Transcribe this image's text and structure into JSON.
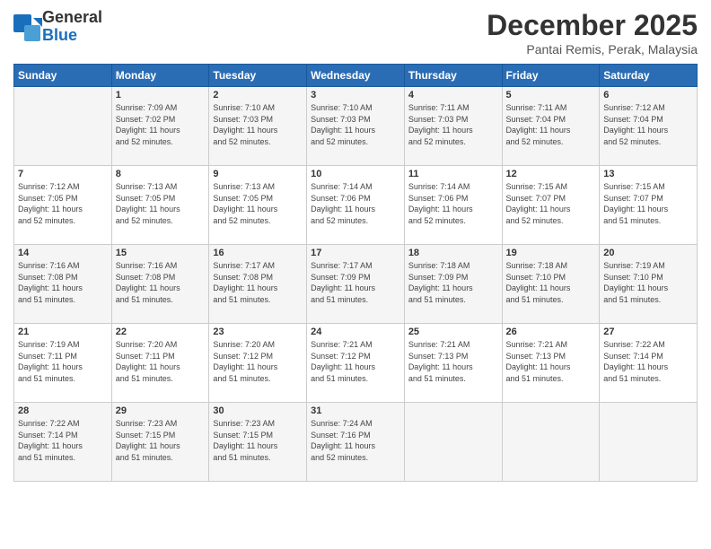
{
  "logo": {
    "line1": "General",
    "line2": "Blue"
  },
  "title": "December 2025",
  "subtitle": "Pantai Remis, Perak, Malaysia",
  "days_header": [
    "Sunday",
    "Monday",
    "Tuesday",
    "Wednesday",
    "Thursday",
    "Friday",
    "Saturday"
  ],
  "weeks": [
    [
      {
        "day": "",
        "info": ""
      },
      {
        "day": "1",
        "info": "Sunrise: 7:09 AM\nSunset: 7:02 PM\nDaylight: 11 hours\nand 52 minutes."
      },
      {
        "day": "2",
        "info": "Sunrise: 7:10 AM\nSunset: 7:03 PM\nDaylight: 11 hours\nand 52 minutes."
      },
      {
        "day": "3",
        "info": "Sunrise: 7:10 AM\nSunset: 7:03 PM\nDaylight: 11 hours\nand 52 minutes."
      },
      {
        "day": "4",
        "info": "Sunrise: 7:11 AM\nSunset: 7:03 PM\nDaylight: 11 hours\nand 52 minutes."
      },
      {
        "day": "5",
        "info": "Sunrise: 7:11 AM\nSunset: 7:04 PM\nDaylight: 11 hours\nand 52 minutes."
      },
      {
        "day": "6",
        "info": "Sunrise: 7:12 AM\nSunset: 7:04 PM\nDaylight: 11 hours\nand 52 minutes."
      }
    ],
    [
      {
        "day": "7",
        "info": "Sunrise: 7:12 AM\nSunset: 7:05 PM\nDaylight: 11 hours\nand 52 minutes."
      },
      {
        "day": "8",
        "info": "Sunrise: 7:13 AM\nSunset: 7:05 PM\nDaylight: 11 hours\nand 52 minutes."
      },
      {
        "day": "9",
        "info": "Sunrise: 7:13 AM\nSunset: 7:05 PM\nDaylight: 11 hours\nand 52 minutes."
      },
      {
        "day": "10",
        "info": "Sunrise: 7:14 AM\nSunset: 7:06 PM\nDaylight: 11 hours\nand 52 minutes."
      },
      {
        "day": "11",
        "info": "Sunrise: 7:14 AM\nSunset: 7:06 PM\nDaylight: 11 hours\nand 52 minutes."
      },
      {
        "day": "12",
        "info": "Sunrise: 7:15 AM\nSunset: 7:07 PM\nDaylight: 11 hours\nand 52 minutes."
      },
      {
        "day": "13",
        "info": "Sunrise: 7:15 AM\nSunset: 7:07 PM\nDaylight: 11 hours\nand 51 minutes."
      }
    ],
    [
      {
        "day": "14",
        "info": "Sunrise: 7:16 AM\nSunset: 7:08 PM\nDaylight: 11 hours\nand 51 minutes."
      },
      {
        "day": "15",
        "info": "Sunrise: 7:16 AM\nSunset: 7:08 PM\nDaylight: 11 hours\nand 51 minutes."
      },
      {
        "day": "16",
        "info": "Sunrise: 7:17 AM\nSunset: 7:08 PM\nDaylight: 11 hours\nand 51 minutes."
      },
      {
        "day": "17",
        "info": "Sunrise: 7:17 AM\nSunset: 7:09 PM\nDaylight: 11 hours\nand 51 minutes."
      },
      {
        "day": "18",
        "info": "Sunrise: 7:18 AM\nSunset: 7:09 PM\nDaylight: 11 hours\nand 51 minutes."
      },
      {
        "day": "19",
        "info": "Sunrise: 7:18 AM\nSunset: 7:10 PM\nDaylight: 11 hours\nand 51 minutes."
      },
      {
        "day": "20",
        "info": "Sunrise: 7:19 AM\nSunset: 7:10 PM\nDaylight: 11 hours\nand 51 minutes."
      }
    ],
    [
      {
        "day": "21",
        "info": "Sunrise: 7:19 AM\nSunset: 7:11 PM\nDaylight: 11 hours\nand 51 minutes."
      },
      {
        "day": "22",
        "info": "Sunrise: 7:20 AM\nSunset: 7:11 PM\nDaylight: 11 hours\nand 51 minutes."
      },
      {
        "day": "23",
        "info": "Sunrise: 7:20 AM\nSunset: 7:12 PM\nDaylight: 11 hours\nand 51 minutes."
      },
      {
        "day": "24",
        "info": "Sunrise: 7:21 AM\nSunset: 7:12 PM\nDaylight: 11 hours\nand 51 minutes."
      },
      {
        "day": "25",
        "info": "Sunrise: 7:21 AM\nSunset: 7:13 PM\nDaylight: 11 hours\nand 51 minutes."
      },
      {
        "day": "26",
        "info": "Sunrise: 7:21 AM\nSunset: 7:13 PM\nDaylight: 11 hours\nand 51 minutes."
      },
      {
        "day": "27",
        "info": "Sunrise: 7:22 AM\nSunset: 7:14 PM\nDaylight: 11 hours\nand 51 minutes."
      }
    ],
    [
      {
        "day": "28",
        "info": "Sunrise: 7:22 AM\nSunset: 7:14 PM\nDaylight: 11 hours\nand 51 minutes."
      },
      {
        "day": "29",
        "info": "Sunrise: 7:23 AM\nSunset: 7:15 PM\nDaylight: 11 hours\nand 51 minutes."
      },
      {
        "day": "30",
        "info": "Sunrise: 7:23 AM\nSunset: 7:15 PM\nDaylight: 11 hours\nand 51 minutes."
      },
      {
        "day": "31",
        "info": "Sunrise: 7:24 AM\nSunset: 7:16 PM\nDaylight: 11 hours\nand 52 minutes."
      },
      {
        "day": "",
        "info": ""
      },
      {
        "day": "",
        "info": ""
      },
      {
        "day": "",
        "info": ""
      }
    ]
  ]
}
